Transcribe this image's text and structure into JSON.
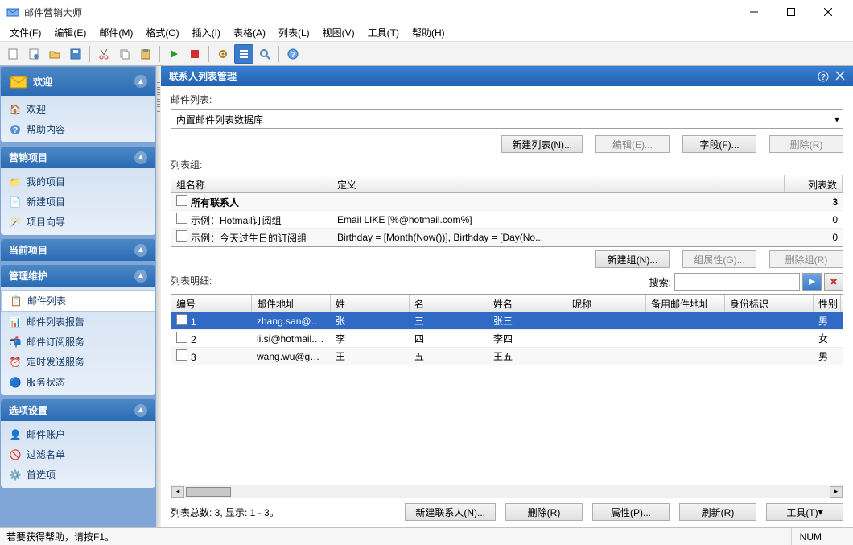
{
  "window": {
    "title": "邮件营销大师"
  },
  "menu": {
    "file": "文件(F)",
    "edit": "编辑(E)",
    "mail": "邮件(M)",
    "format": "格式(O)",
    "insert": "插入(I)",
    "table": "表格(A)",
    "list": "列表(L)",
    "view": "视图(V)",
    "tools": "工具(T)",
    "help": "帮助(H)"
  },
  "sidebar": {
    "welcome": {
      "header": "欢迎",
      "items": [
        {
          "label": "欢迎"
        },
        {
          "label": "帮助内容"
        }
      ]
    },
    "marketing": {
      "header": "营销项目",
      "items": [
        {
          "label": "我的项目"
        },
        {
          "label": "新建项目"
        },
        {
          "label": "项目向导"
        }
      ]
    },
    "current": {
      "header": "当前项目"
    },
    "maintain": {
      "header": "管理维护",
      "items": [
        {
          "label": "邮件列表"
        },
        {
          "label": "邮件列表报告"
        },
        {
          "label": "邮件订阅服务"
        },
        {
          "label": "定时发送服务"
        },
        {
          "label": "服务状态"
        }
      ]
    },
    "options": {
      "header": "选项设置",
      "items": [
        {
          "label": "邮件账户"
        },
        {
          "label": "过滤名单"
        },
        {
          "label": "首选项"
        }
      ]
    }
  },
  "pane": {
    "title": "联系人列表管理",
    "listLabel": "邮件列表:",
    "listSelected": "内置邮件列表数据库",
    "buttons": {
      "newList": "新建列表(N)...",
      "edit": "编辑(E)...",
      "fields": "字段(F)...",
      "delete": "删除(R)"
    },
    "groupLabel": "列表组:",
    "groupHeaders": {
      "name": "组名称",
      "def": "定义",
      "count": "列表数"
    },
    "groups": [
      {
        "name": "所有联系人",
        "def": "",
        "count": "3",
        "bold": true
      },
      {
        "name": "示例：Hotmail订阅组",
        "def": "Email LIKE [%@hotmail.com%]",
        "count": "0"
      },
      {
        "name": "示例：今天过生日的订阅组",
        "def": "Birthday = [Month(Now())], Birthday = [Day(No...",
        "count": "0"
      }
    ],
    "groupButtons": {
      "newGroup": "新建组(N)...",
      "groupProps": "组属性(G)...",
      "deleteGroup": "删除组(R)"
    },
    "detailLabel": "列表明细:",
    "searchLabel": "搜索:",
    "contactHeaders": {
      "c0": "编号",
      "c1": "邮件地址",
      "c2": "姓",
      "c3": "名",
      "c4": "姓名",
      "c5": "昵称",
      "c6": "备用邮件地址",
      "c7": "身份标识",
      "c8": "性别"
    },
    "contacts": [
      {
        "id": "1",
        "email": "zhang.san@ho...",
        "last": "张",
        "first": "三",
        "name": "张三",
        "nick": "",
        "alt": "",
        "ident": "",
        "gender": "男"
      },
      {
        "id": "2",
        "email": "li.si@hotmail.c...",
        "last": "李",
        "first": "四",
        "name": "李四",
        "nick": "",
        "alt": "",
        "ident": "",
        "gender": "女"
      },
      {
        "id": "3",
        "email": "wang.wu@gm...",
        "last": "王",
        "first": "五",
        "name": "王五",
        "nick": "",
        "alt": "",
        "ident": "",
        "gender": "男"
      }
    ],
    "footer": {
      "summary": "列表总数: 3, 显示: 1 - 3。",
      "newContact": "新建联系人(N)...",
      "delete": "删除(R)",
      "props": "属性(P)...",
      "refresh": "刷新(R)",
      "tools": "工具(T)"
    }
  },
  "status": {
    "help": "若要获得帮助，请按F1。",
    "num": "NUM"
  }
}
